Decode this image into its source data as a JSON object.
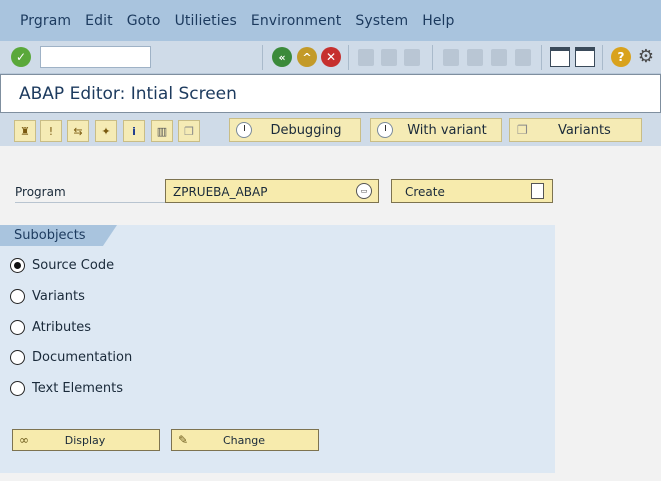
{
  "menu": {
    "items": [
      "Prgram",
      "Edit",
      "Goto",
      "Utilieties",
      "Environment",
      "System",
      "Help"
    ]
  },
  "toolbar": {
    "command_field_value": "",
    "icons": [
      "check-icon",
      "back-icon",
      "exit-icon",
      "cancel-icon",
      "print-icon",
      "find-icon",
      "find-next-icon",
      "first-page-icon",
      "previous-page-icon",
      "next-page-icon",
      "last-page-icon",
      "create-session-icon",
      "shortcut-icon",
      "help-icon",
      "settings-icon"
    ]
  },
  "title": "ABAP Editor: Intial Screen",
  "app_toolbar": {
    "debugging_label": "Debugging",
    "with_variant_label": "With variant",
    "variants_label": "Variants"
  },
  "program": {
    "label": "Program",
    "value": "ZPRUEBA_ABAP",
    "create_label": "Create"
  },
  "subobjects": {
    "title": "Subobjects",
    "options": [
      {
        "label": "Source Code",
        "selected": true
      },
      {
        "label": "Variants",
        "selected": false
      },
      {
        "label": "Atributes",
        "selected": false
      },
      {
        "label": "Documentation",
        "selected": false
      },
      {
        "label": "Text Elements",
        "selected": false
      }
    ]
  },
  "actions": {
    "display_label": "Display",
    "change_label": "Change"
  },
  "colors": {
    "menubar": "#a9c4de",
    "toolbar": "#cfdbe8",
    "button_yellow": "#f7ebad",
    "panel": "#dde8f3"
  }
}
